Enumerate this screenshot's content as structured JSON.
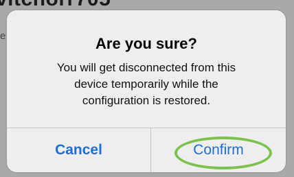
{
  "background": {
    "title_fragment": "vitchorr705",
    "edge_fragment": "e"
  },
  "alert": {
    "title": "Are you sure?",
    "message_lines": [
      "You will get disconnected from this",
      "device temporarily while the",
      "configuration is restored."
    ],
    "buttons": {
      "cancel": "Cancel",
      "confirm": "Confirm"
    }
  },
  "colors": {
    "button_text": "#1a6fd6",
    "highlight_ring": "#7cc14e",
    "alert_background": "#eeeeee"
  }
}
